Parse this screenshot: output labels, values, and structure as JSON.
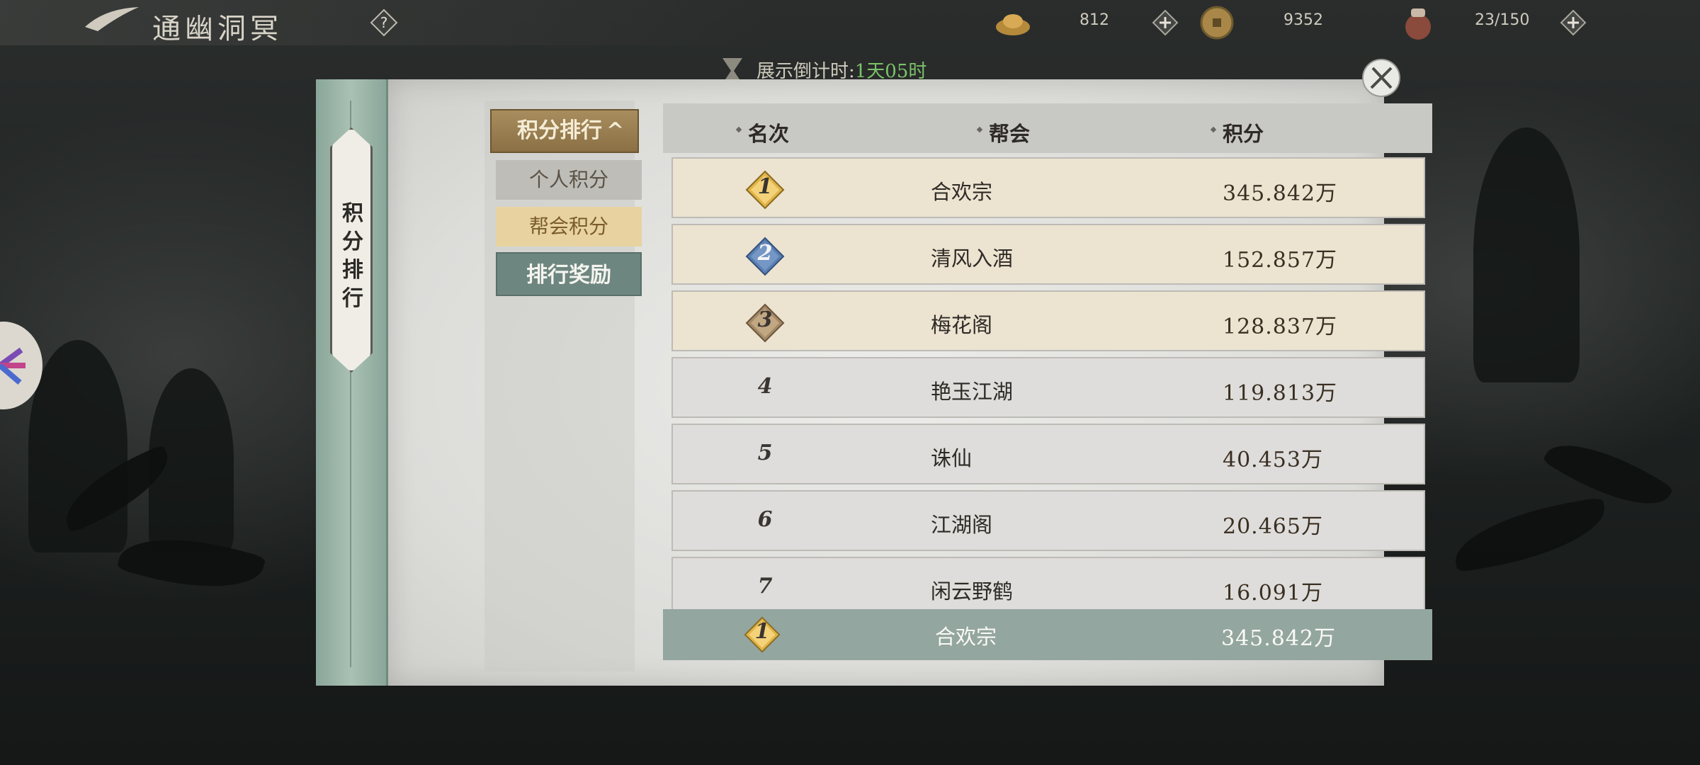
{
  "header": {
    "scene_title": "通幽洞冥",
    "help_icon": "question-mark-icon",
    "resources": [
      {
        "icon": "gold-ingot-icon",
        "value": "812"
      },
      {
        "icon": "bronze-coin-icon",
        "value": "9352"
      },
      {
        "icon": "wine-jar-icon",
        "value": "23/150"
      }
    ]
  },
  "countdown": {
    "label": "展示倒计时:",
    "value": "1天05时"
  },
  "side_tab": {
    "label": "积分排行"
  },
  "menu": {
    "header_label": "积分排行",
    "header_arrow": "^",
    "items": [
      {
        "label": "个人积分",
        "state": "normal"
      },
      {
        "label": "帮会积分",
        "state": "selected"
      },
      {
        "label": "排行奖励",
        "state": "button"
      }
    ]
  },
  "table": {
    "columns": [
      "名次",
      "帮会",
      "积分"
    ],
    "rows": [
      {
        "rank": "1",
        "guild": "合欢宗",
        "score": "345.842万"
      },
      {
        "rank": "2",
        "guild": "清风入酒",
        "score": "152.857万"
      },
      {
        "rank": "3",
        "guild": "梅花阁",
        "score": "128.837万"
      },
      {
        "rank": "4",
        "guild": "艳玉江湖",
        "score": "119.813万"
      },
      {
        "rank": "5",
        "guild": "诛仙",
        "score": "40.453万"
      },
      {
        "rank": "6",
        "guild": "江湖阁",
        "score": "20.465万"
      },
      {
        "rank": "7",
        "guild": "闲云野鹤",
        "score": "16.091万"
      }
    ],
    "my_guild": {
      "rank": "1",
      "guild": "合欢宗",
      "score": "345.842万"
    }
  },
  "colors": {
    "gold_badge": "#e0b448",
    "blue_badge": "#5b7fb0",
    "bronze_badge": "#a48a66",
    "accent_green": "#7cc26a"
  }
}
